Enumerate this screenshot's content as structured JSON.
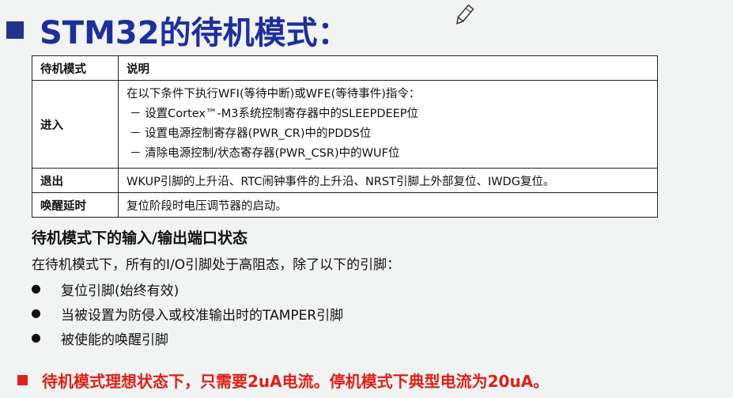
{
  "title": "STM32的待机模式：",
  "table": {
    "header": {
      "mode": "待机模式",
      "desc": "说明"
    },
    "enter": {
      "label": "进入",
      "lines": [
        "在以下条件下执行WFI(等待中断)或WFE(等待事件)指令：",
        "－ 设置Cortex™-M3系统控制寄存器中的SLEEPDEEP位",
        "－ 设置电源控制寄存器(PWR_CR)中的PDDS位",
        "－ 清除电源控制/状态寄存器(PWR_CSR)中的WUF位"
      ]
    },
    "exit": {
      "label": "退出",
      "text": "WKUP引脚的上升沿、RTC闹钟事件的上升沿、NRST引脚上外部复位、IWDG复位。"
    },
    "wake": {
      "label": "唤醒延时",
      "text": "复位阶段时电压调节器的启动。"
    }
  },
  "io_section": {
    "title": "待机模式下的输入/输出端口状态",
    "intro": "在待机模式下，所有的I/O引脚处于高阻态，除了以下的引脚：",
    "items": [
      "复位引脚(始终有效)",
      "当被设置为防侵入或校准输出时的TAMPER引脚",
      "被使能的唤醒引脚"
    ]
  },
  "note": "待机模式理想状态下，只需要2uA电流。停机模式下典型电流为20uA。",
  "colors": {
    "title": "#1d2f9b",
    "note": "#e02018"
  },
  "icons": {
    "pen": "pencil-icon"
  }
}
